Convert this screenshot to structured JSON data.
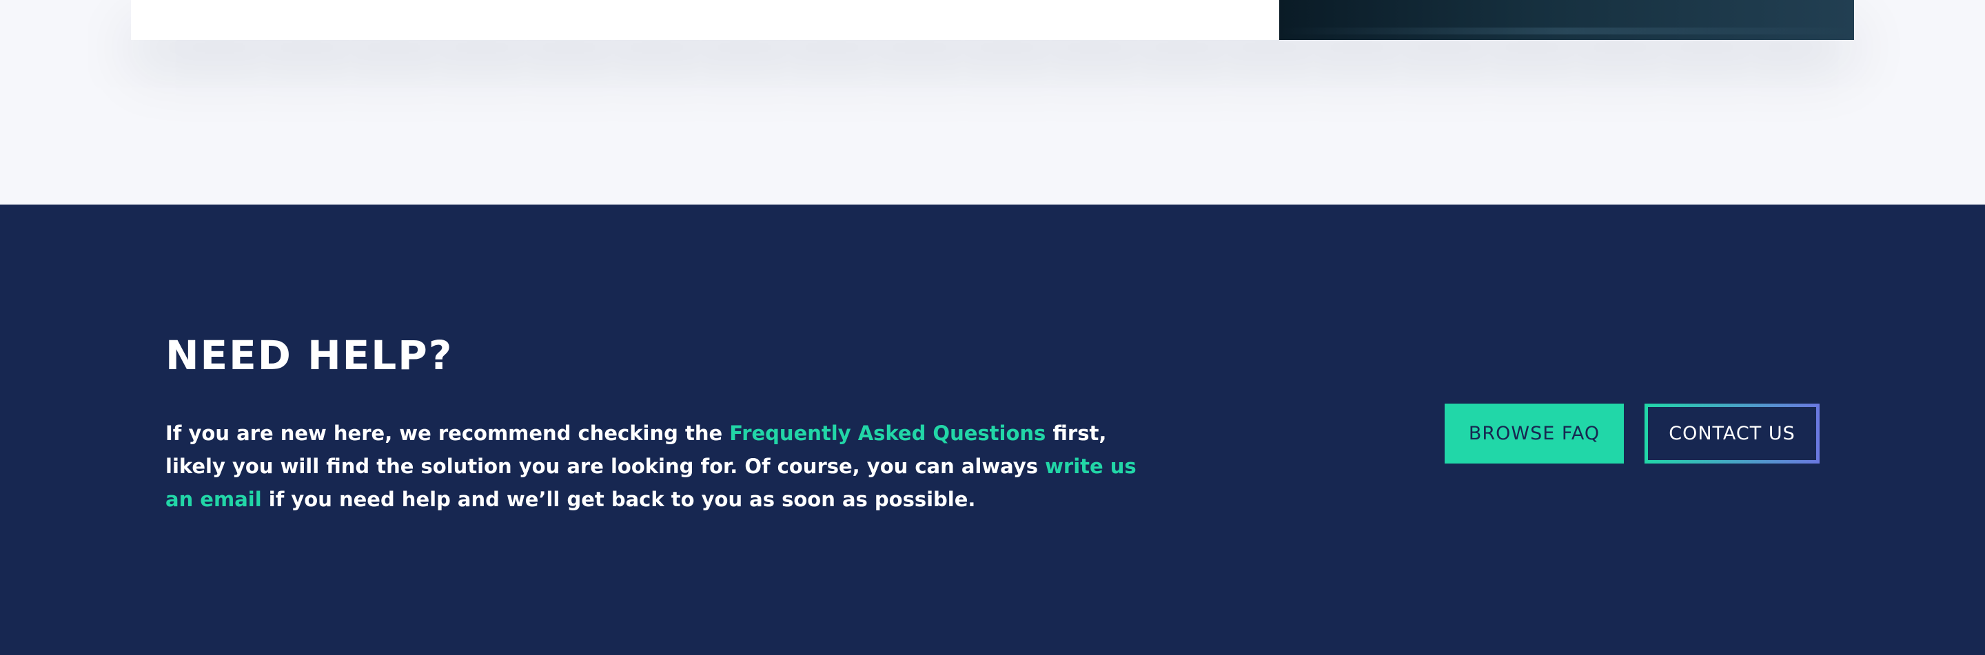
{
  "help": {
    "title": "NEED HELP?",
    "text_1": "If you are new here, we recommend checking the ",
    "faq_link": "Frequently Asked Questions",
    "text_2": " first, likely you will find the solution you are looking for. Of course, you can always ",
    "email_link": "write us an email",
    "text_3": " if you need help and we’ll get back to you as soon as possible.",
    "browse_faq_label": "BROWSE FAQ",
    "contact_label": "CONTACT US"
  },
  "colors": {
    "section_background": "#172751",
    "accent": "#21d7a8",
    "gradient_end": "#6b78e0",
    "page_background": "#f6f7fb"
  }
}
